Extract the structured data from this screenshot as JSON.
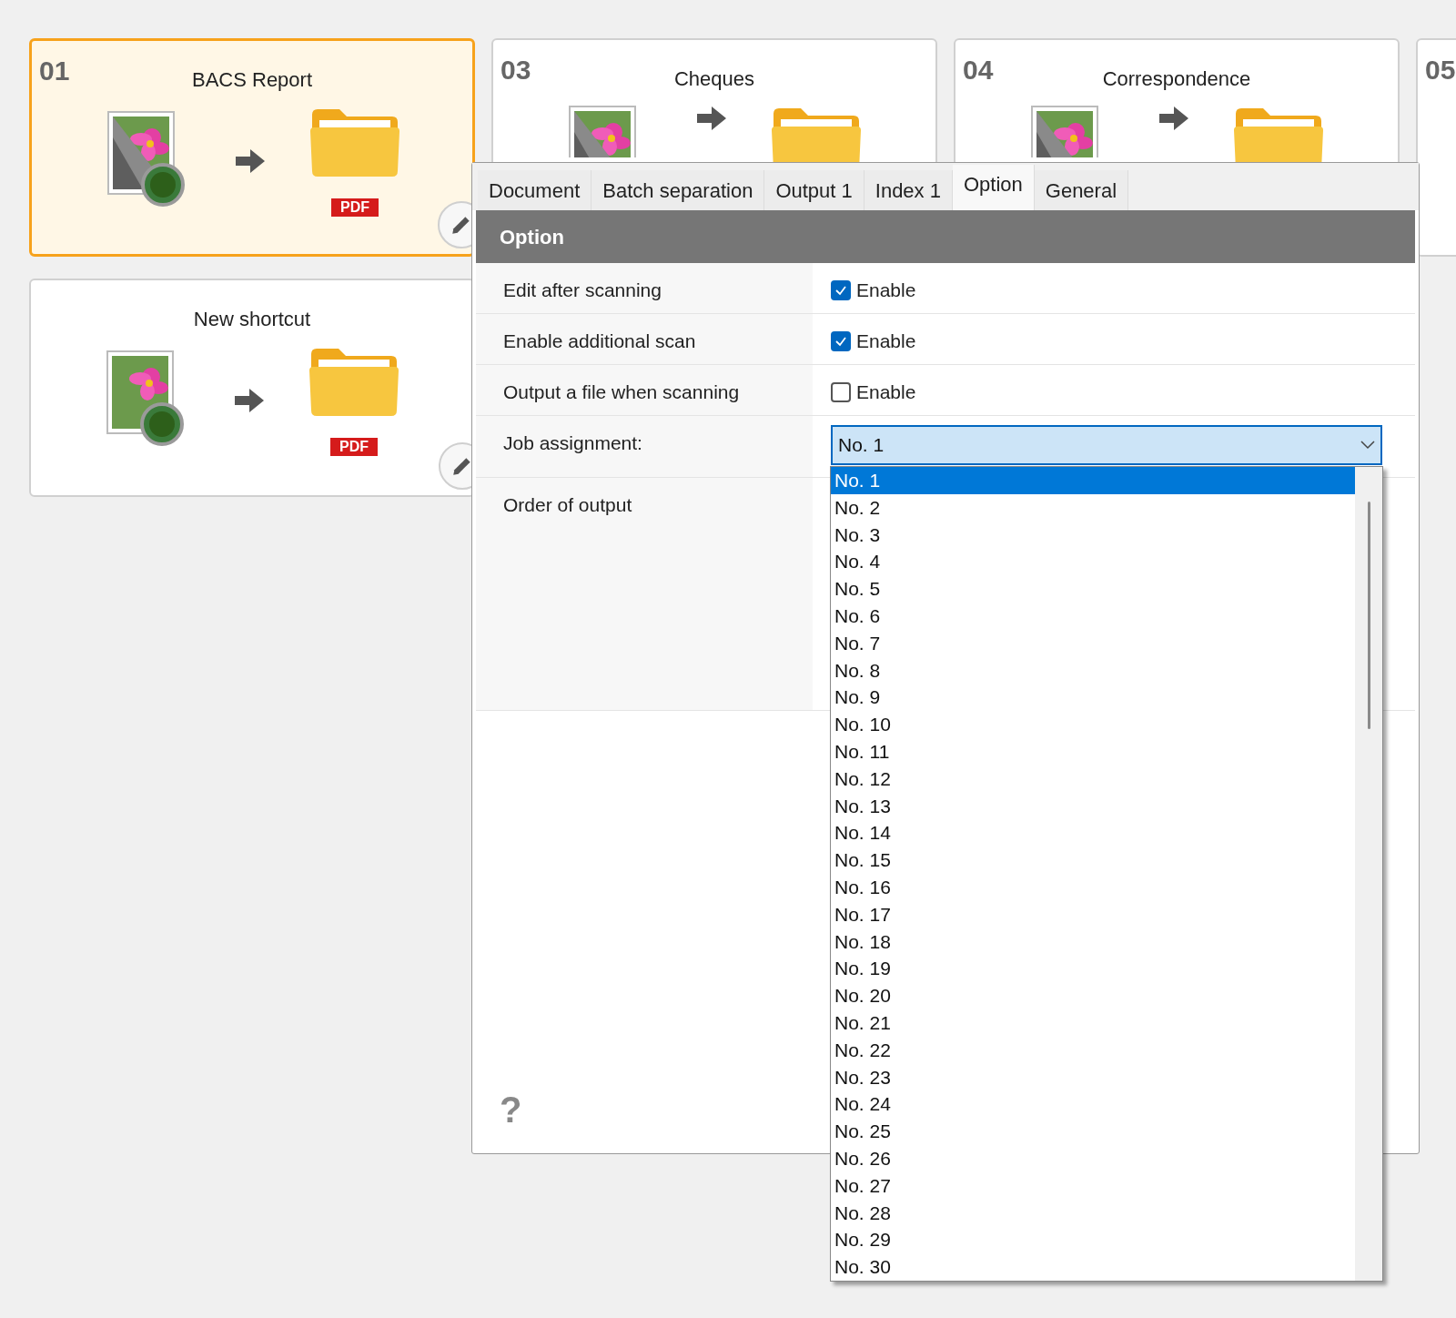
{
  "shortcuts": [
    {
      "number": "01",
      "title": "BACS Report",
      "selected": true,
      "half_grayscale": true,
      "badge": "PDF",
      "editable": true
    },
    {
      "number": "03",
      "title": "Cheques",
      "selected": false,
      "half_grayscale": true
    },
    {
      "number": "04",
      "title": "Correspondence",
      "selected": false,
      "half_grayscale": true
    },
    {
      "number": "05",
      "selected": false
    }
  ],
  "new_shortcut": {
    "title": "New shortcut",
    "selected": false,
    "half_grayscale": false,
    "badge": "PDF",
    "editable": true
  },
  "dialog": {
    "tabs": [
      {
        "label": "Document",
        "selected": false
      },
      {
        "label": "Batch separation",
        "selected": false
      },
      {
        "label": "Output 1",
        "selected": false
      },
      {
        "label": "Index 1",
        "selected": false
      },
      {
        "label": "Option",
        "selected": true
      },
      {
        "label": "General",
        "selected": false
      }
    ],
    "section_title": "Option",
    "rows": [
      {
        "kind": "checkbox",
        "label": "Edit after scanning",
        "text": "Enable",
        "checked": true
      },
      {
        "kind": "checkbox",
        "label": "Enable additional scan",
        "text": "Enable",
        "checked": true
      },
      {
        "kind": "checkbox",
        "label": "Output a file when scanning",
        "text": "Enable",
        "checked": false
      },
      {
        "kind": "select",
        "label": "Job assignment:",
        "value": "No. 1"
      },
      {
        "kind": "blank",
        "label": "Order of output"
      }
    ],
    "help": "?",
    "dropdown_options": [
      {
        "label": "No. 1",
        "selected": true
      },
      {
        "label": "No. 2",
        "selected": false
      },
      {
        "label": "No. 3",
        "selected": false
      },
      {
        "label": "No. 4",
        "selected": false
      },
      {
        "label": "No. 5",
        "selected": false
      },
      {
        "label": "No. 6",
        "selected": false
      },
      {
        "label": "No. 7",
        "selected": false
      },
      {
        "label": "No. 8",
        "selected": false
      },
      {
        "label": "No. 9",
        "selected": false
      },
      {
        "label": "No. 10",
        "selected": false
      },
      {
        "label": "No. 11",
        "selected": false
      },
      {
        "label": "No. 12",
        "selected": false
      },
      {
        "label": "No. 13",
        "selected": false
      },
      {
        "label": "No. 14",
        "selected": false
      },
      {
        "label": "No. 15",
        "selected": false
      },
      {
        "label": "No. 16",
        "selected": false
      },
      {
        "label": "No. 17",
        "selected": false
      },
      {
        "label": "No. 18",
        "selected": false
      },
      {
        "label": "No. 19",
        "selected": false
      },
      {
        "label": "No. 20",
        "selected": false
      },
      {
        "label": "No. 21",
        "selected": false
      },
      {
        "label": "No. 22",
        "selected": false
      },
      {
        "label": "No. 23",
        "selected": false
      },
      {
        "label": "No. 24",
        "selected": false
      },
      {
        "label": "No. 25",
        "selected": false
      },
      {
        "label": "No. 26",
        "selected": false
      },
      {
        "label": "No. 27",
        "selected": false
      },
      {
        "label": "No. 28",
        "selected": false
      },
      {
        "label": "No. 29",
        "selected": false
      },
      {
        "label": "No. 30",
        "selected": false
      }
    ]
  }
}
